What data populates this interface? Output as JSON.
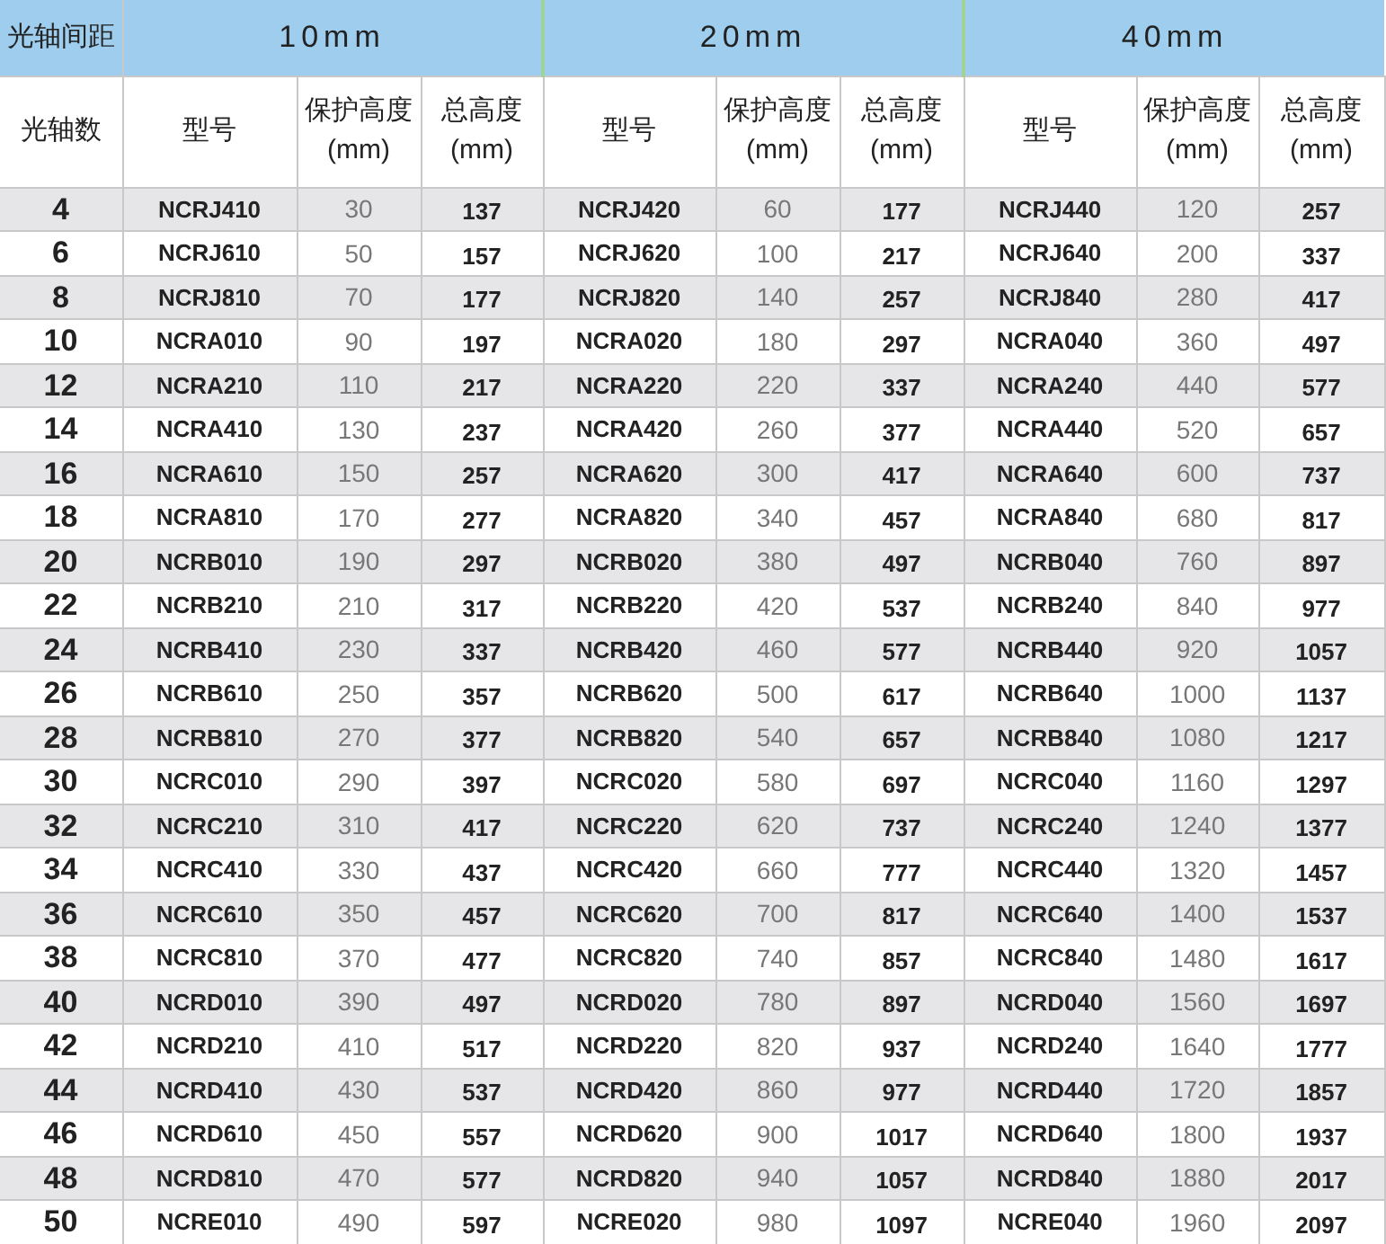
{
  "corner_label": "光轴间距",
  "count_heading": "光轴数",
  "groups": [
    {
      "label": "10mm",
      "columns": [
        "型号",
        "保护高度\n(mm)",
        "总高度\n(mm)"
      ]
    },
    {
      "label": "20mm",
      "columns": [
        "型号",
        "保护高度\n(mm)",
        "总高度\n(mm)"
      ]
    },
    {
      "label": "40mm",
      "columns": [
        "型号",
        "保护高度\n(mm)",
        "总高度\n(mm)"
      ]
    }
  ],
  "rows": [
    {
      "count": "4",
      "cells": [
        [
          "NCRJ410",
          "30",
          "137"
        ],
        [
          "NCRJ420",
          "60",
          "177"
        ],
        [
          "NCRJ440",
          "120",
          "257"
        ]
      ]
    },
    {
      "count": "6",
      "cells": [
        [
          "NCRJ610",
          "50",
          "157"
        ],
        [
          "NCRJ620",
          "100",
          "217"
        ],
        [
          "NCRJ640",
          "200",
          "337"
        ]
      ]
    },
    {
      "count": "8",
      "cells": [
        [
          "NCRJ810",
          "70",
          "177"
        ],
        [
          "NCRJ820",
          "140",
          "257"
        ],
        [
          "NCRJ840",
          "280",
          "417"
        ]
      ]
    },
    {
      "count": "10",
      "cells": [
        [
          "NCRA010",
          "90",
          "197"
        ],
        [
          "NCRA020",
          "180",
          "297"
        ],
        [
          "NCRA040",
          "360",
          "497"
        ]
      ]
    },
    {
      "count": "12",
      "cells": [
        [
          "NCRA210",
          "110",
          "217"
        ],
        [
          "NCRA220",
          "220",
          "337"
        ],
        [
          "NCRA240",
          "440",
          "577"
        ]
      ]
    },
    {
      "count": "14",
      "cells": [
        [
          "NCRA410",
          "130",
          "237"
        ],
        [
          "NCRA420",
          "260",
          "377"
        ],
        [
          "NCRA440",
          "520",
          "657"
        ]
      ]
    },
    {
      "count": "16",
      "cells": [
        [
          "NCRA610",
          "150",
          "257"
        ],
        [
          "NCRA620",
          "300",
          "417"
        ],
        [
          "NCRA640",
          "600",
          "737"
        ]
      ]
    },
    {
      "count": "18",
      "cells": [
        [
          "NCRA810",
          "170",
          "277"
        ],
        [
          "NCRA820",
          "340",
          "457"
        ],
        [
          "NCRA840",
          "680",
          "817"
        ]
      ]
    },
    {
      "count": "20",
      "cells": [
        [
          "NCRB010",
          "190",
          "297"
        ],
        [
          "NCRB020",
          "380",
          "497"
        ],
        [
          "NCRB040",
          "760",
          "897"
        ]
      ]
    },
    {
      "count": "22",
      "cells": [
        [
          "NCRB210",
          "210",
          "317"
        ],
        [
          "NCRB220",
          "420",
          "537"
        ],
        [
          "NCRB240",
          "840",
          "977"
        ]
      ]
    },
    {
      "count": "24",
      "cells": [
        [
          "NCRB410",
          "230",
          "337"
        ],
        [
          "NCRB420",
          "460",
          "577"
        ],
        [
          "NCRB440",
          "920",
          "1057"
        ]
      ]
    },
    {
      "count": "26",
      "cells": [
        [
          "NCRB610",
          "250",
          "357"
        ],
        [
          "NCRB620",
          "500",
          "617"
        ],
        [
          "NCRB640",
          "1000",
          "1137"
        ]
      ]
    },
    {
      "count": "28",
      "cells": [
        [
          "NCRB810",
          "270",
          "377"
        ],
        [
          "NCRB820",
          "540",
          "657"
        ],
        [
          "NCRB840",
          "1080",
          "1217"
        ]
      ]
    },
    {
      "count": "30",
      "cells": [
        [
          "NCRC010",
          "290",
          "397"
        ],
        [
          "NCRC020",
          "580",
          "697"
        ],
        [
          "NCRC040",
          "1160",
          "1297"
        ]
      ]
    },
    {
      "count": "32",
      "cells": [
        [
          "NCRC210",
          "310",
          "417"
        ],
        [
          "NCRC220",
          "620",
          "737"
        ],
        [
          "NCRC240",
          "1240",
          "1377"
        ]
      ]
    },
    {
      "count": "34",
      "cells": [
        [
          "NCRC410",
          "330",
          "437"
        ],
        [
          "NCRC420",
          "660",
          "777"
        ],
        [
          "NCRC440",
          "1320",
          "1457"
        ]
      ]
    },
    {
      "count": "36",
      "cells": [
        [
          "NCRC610",
          "350",
          "457"
        ],
        [
          "NCRC620",
          "700",
          "817"
        ],
        [
          "NCRC640",
          "1400",
          "1537"
        ]
      ]
    },
    {
      "count": "38",
      "cells": [
        [
          "NCRC810",
          "370",
          "477"
        ],
        [
          "NCRC820",
          "740",
          "857"
        ],
        [
          "NCRC840",
          "1480",
          "1617"
        ]
      ]
    },
    {
      "count": "40",
      "cells": [
        [
          "NCRD010",
          "390",
          "497"
        ],
        [
          "NCRD020",
          "780",
          "897"
        ],
        [
          "NCRD040",
          "1560",
          "1697"
        ]
      ]
    },
    {
      "count": "42",
      "cells": [
        [
          "NCRD210",
          "410",
          "517"
        ],
        [
          "NCRD220",
          "820",
          "937"
        ],
        [
          "NCRD240",
          "1640",
          "1777"
        ]
      ]
    },
    {
      "count": "44",
      "cells": [
        [
          "NCRD410",
          "430",
          "537"
        ],
        [
          "NCRD420",
          "860",
          "977"
        ],
        [
          "NCRD440",
          "1720",
          "1857"
        ]
      ]
    },
    {
      "count": "46",
      "cells": [
        [
          "NCRD610",
          "450",
          "557"
        ],
        [
          "NCRD620",
          "900",
          "1017"
        ],
        [
          "NCRD640",
          "1800",
          "1937"
        ]
      ]
    },
    {
      "count": "48",
      "cells": [
        [
          "NCRD810",
          "470",
          "577"
        ],
        [
          "NCRD820",
          "940",
          "1057"
        ],
        [
          "NCRD840",
          "1880",
          "2017"
        ]
      ]
    },
    {
      "count": "50",
      "cells": [
        [
          "NCRE010",
          "490",
          "597"
        ],
        [
          "NCRE020",
          "980",
          "1097"
        ],
        [
          "NCRE040",
          "1960",
          "2097"
        ]
      ]
    }
  ]
}
